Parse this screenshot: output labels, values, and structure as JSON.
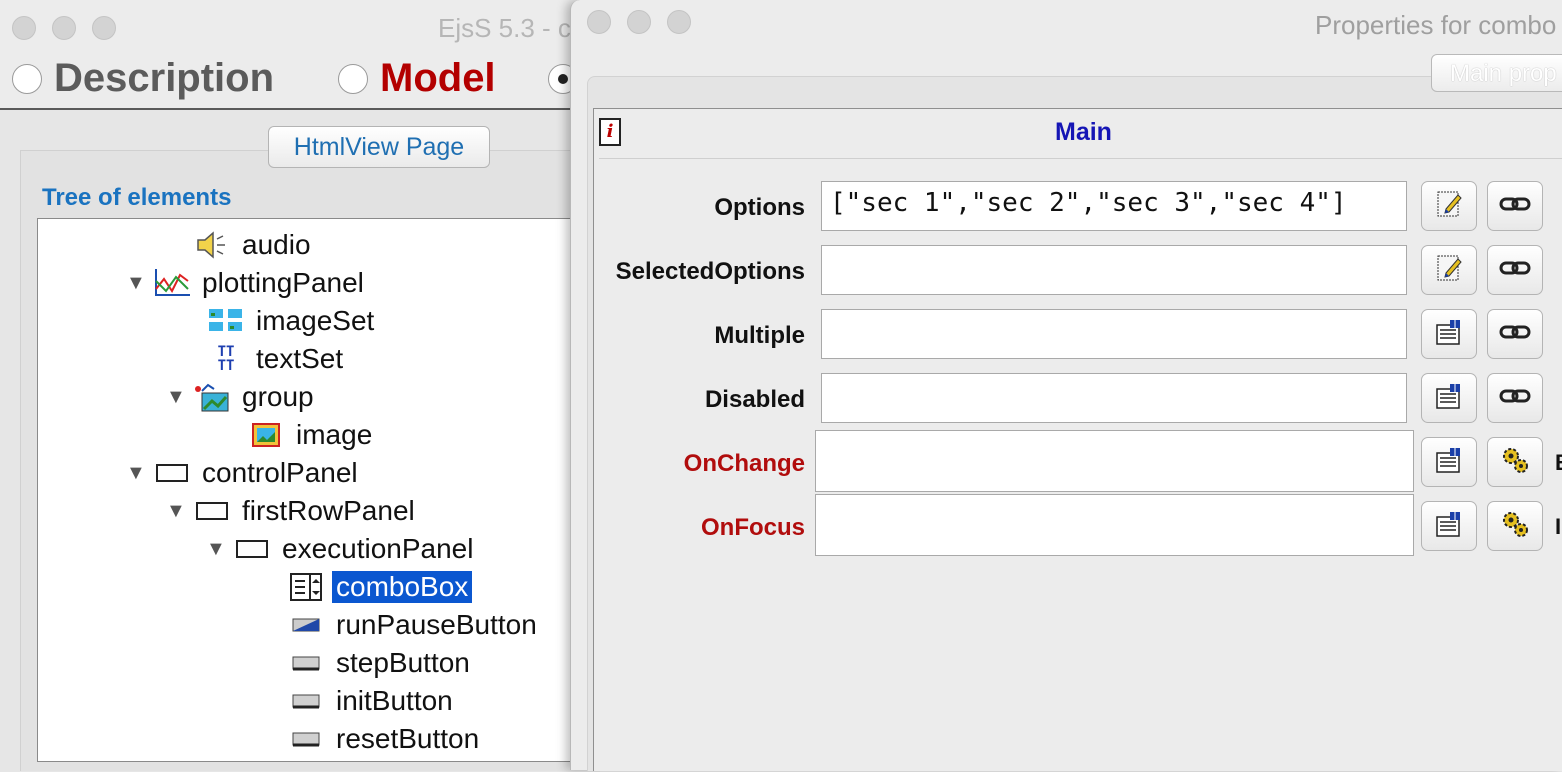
{
  "back_window": {
    "title": "EjsS 5.3 - c",
    "radios": [
      {
        "label": "Description",
        "color": "#5b5b5b",
        "selected": false
      },
      {
        "label": "Model",
        "color": "#b30000",
        "selected": false
      },
      {
        "label": "",
        "selected": true
      }
    ],
    "page_tab": "HtmlView Page",
    "tree_heading": "Tree of elements",
    "tree": [
      {
        "label": "audio",
        "icon": "audio-icon"
      },
      {
        "label": "plottingPanel",
        "icon": "plotting-panel-icon",
        "expanded": true
      },
      {
        "label": "imageSet",
        "icon": "image-set-icon"
      },
      {
        "label": "textSet",
        "icon": "text-set-icon"
      },
      {
        "label": "group",
        "icon": "group-icon",
        "expanded": true
      },
      {
        "label": "image",
        "icon": "image-icon"
      },
      {
        "label": "controlPanel",
        "icon": "panel-icon",
        "expanded": true
      },
      {
        "label": "firstRowPanel",
        "icon": "panel-icon",
        "expanded": true
      },
      {
        "label": "executionPanel",
        "icon": "panel-icon",
        "expanded": true
      },
      {
        "label": "comboBox",
        "icon": "combo-box-icon",
        "selected": true
      },
      {
        "label": "runPauseButton",
        "icon": "two-state-button-icon"
      },
      {
        "label": "stepButton",
        "icon": "button-icon"
      },
      {
        "label": "initButton",
        "icon": "button-icon"
      },
      {
        "label": "resetButton",
        "icon": "button-icon"
      }
    ]
  },
  "props_window": {
    "title": "Properties for combo",
    "tab_label": "Main prop",
    "section_title": "Main",
    "properties": [
      {
        "label": "Options",
        "value": "[\"sec 1\",\"sec 2\",\"sec 3\",\"sec 4\"]",
        "event": false
      },
      {
        "label": "SelectedOptions",
        "value": "",
        "event": false
      },
      {
        "label": "Multiple",
        "value": "",
        "event": false
      },
      {
        "label": "Disabled",
        "value": "",
        "event": false
      },
      {
        "label": "OnChange",
        "value": "",
        "event": true,
        "trailing": "B"
      },
      {
        "label": "OnFocus",
        "value": "",
        "event": true,
        "trailing": "I"
      }
    ]
  }
}
